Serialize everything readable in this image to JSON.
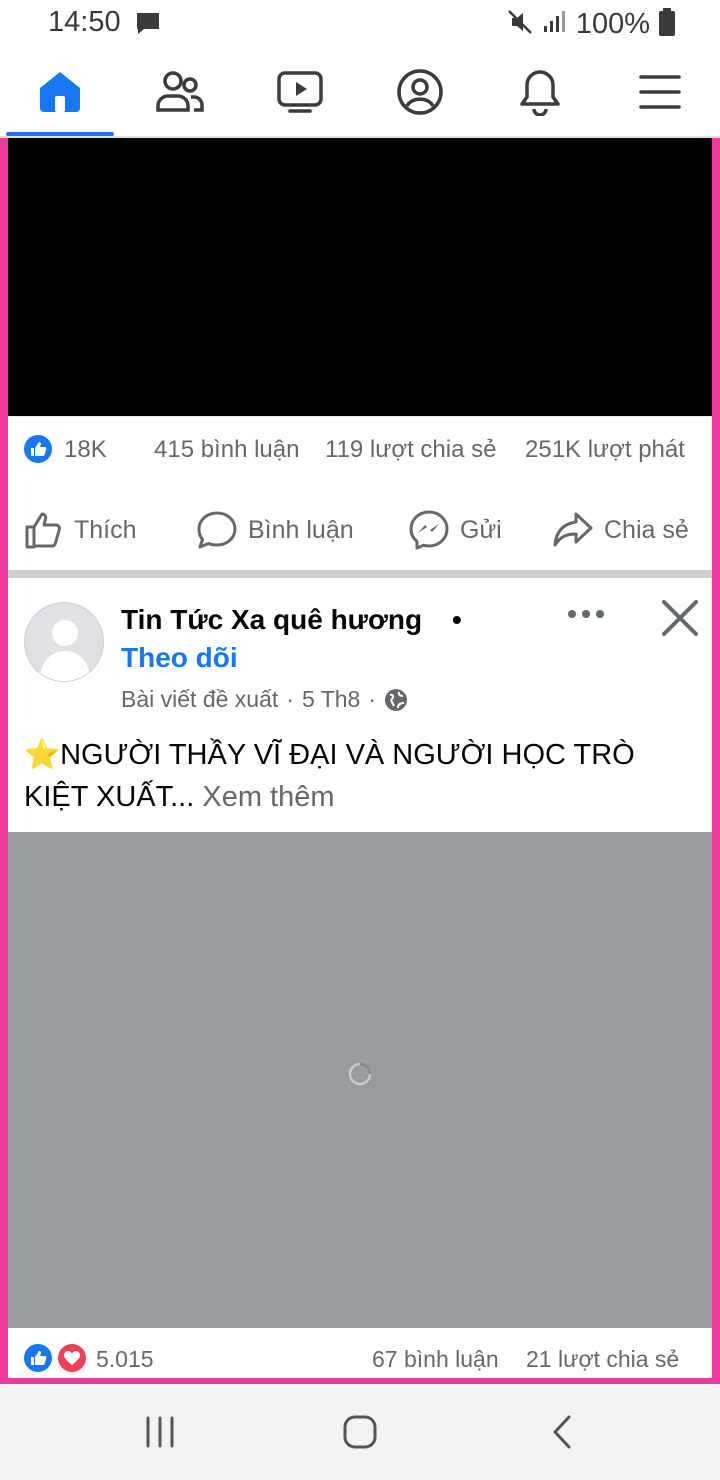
{
  "status_bar": {
    "time": "14:50",
    "battery": "100%",
    "icons": [
      "message-icon",
      "mute-icon",
      "signal-icon",
      "battery-icon"
    ]
  },
  "top_nav": {
    "tabs": [
      {
        "name": "home",
        "icon": "home-icon",
        "active": true
      },
      {
        "name": "friends",
        "icon": "friends-icon",
        "active": false
      },
      {
        "name": "watch",
        "icon": "video-icon",
        "active": false
      },
      {
        "name": "profile",
        "icon": "profile-icon",
        "active": false
      },
      {
        "name": "notifications",
        "icon": "bell-icon",
        "active": false
      },
      {
        "name": "menu",
        "icon": "menu-icon",
        "active": false
      }
    ],
    "accent": "#1877f2"
  },
  "post1": {
    "stats": {
      "reactions": "18K",
      "comments": "415 bình luận",
      "shares": "119 lượt chia sẻ",
      "plays": "251K lượt phát"
    },
    "actions": {
      "like": "Thích",
      "comment": "Bình luận",
      "send": "Gửi",
      "share": "Chia sẻ"
    }
  },
  "post2": {
    "page_name": "Tin Tức Xa quê hương",
    "separator": "•",
    "follow": "Theo dõi",
    "meta_suggested": "Bài viết đề xuất",
    "meta_dot": "·",
    "meta_date": "5 Th8",
    "text": "⭐NGƯỜI THẦY VĨ ĐẠI VÀ NGƯỜI HỌC TRÒ KIỆT XUẤT...",
    "see_more": "Xem thêm",
    "stats": {
      "reactions": "5.015",
      "comments": "67 bình luận",
      "shares": "21 lượt chia sẻ"
    }
  },
  "colors": {
    "frame": "#f0399c",
    "like": "#1877f2",
    "love": "#f33e58"
  }
}
